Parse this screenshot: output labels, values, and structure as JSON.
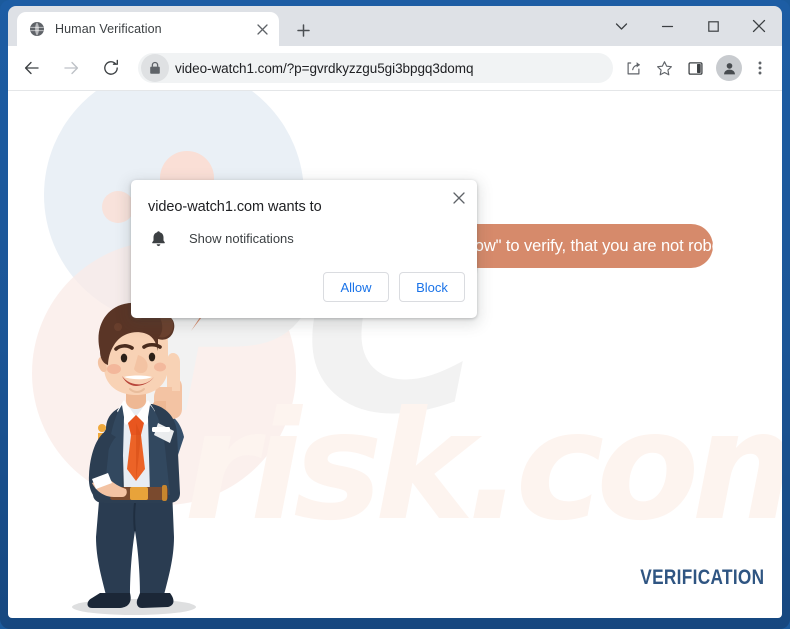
{
  "browser": {
    "tab": {
      "title": "Human Verification",
      "favicon_icon": "globe-icon",
      "close_icon": "close-icon"
    },
    "new_tab_icon": "plus-icon",
    "window_controls": {
      "tab_search_icon": "chevron-down-icon",
      "minimize_icon": "minimize-icon",
      "maximize_icon": "maximize-icon",
      "close_icon": "close-icon"
    },
    "toolbar": {
      "back_icon": "arrow-left-icon",
      "forward_icon": "arrow-right-icon",
      "reload_icon": "reload-icon",
      "site_info_icon": "lock-icon",
      "url": "video-watch1.com/?p=gvrdkyzzgu5gi3bpgq3domq",
      "share_icon": "share-icon",
      "bookmark_icon": "star-icon",
      "side_panel_icon": "side-panel-icon",
      "profile_icon": "person-icon",
      "menu_icon": "three-dot-menu-icon"
    }
  },
  "dialog": {
    "title": "video-watch1.com wants to",
    "permission_icon": "bell-icon",
    "permission_label": "Show notifications",
    "allow_label": "Allow",
    "block_label": "Block",
    "close_icon": "close-icon"
  },
  "page": {
    "speech_bubble_text": "Press \"Allow\" to verify, that you are not robot",
    "verification_label": "VERIFICATION",
    "watermark_top": "PC",
    "watermark_bottom": "risk.com",
    "character_alt": "cartoon-businessman-pointing-up"
  },
  "colors": {
    "window_frame": "#1b5596",
    "tabstrip": "#dee1e6",
    "omnibox": "#f1f3f4",
    "dialog_link": "#1a73e8",
    "speech_bubble": "#d68a6b",
    "verification_text": "#2f5582",
    "bg_circle_blue": "#eaf0f6",
    "bg_circle_pink": "#f9ebe7",
    "suit": "#2c3e52",
    "tie": "#e8561f"
  }
}
